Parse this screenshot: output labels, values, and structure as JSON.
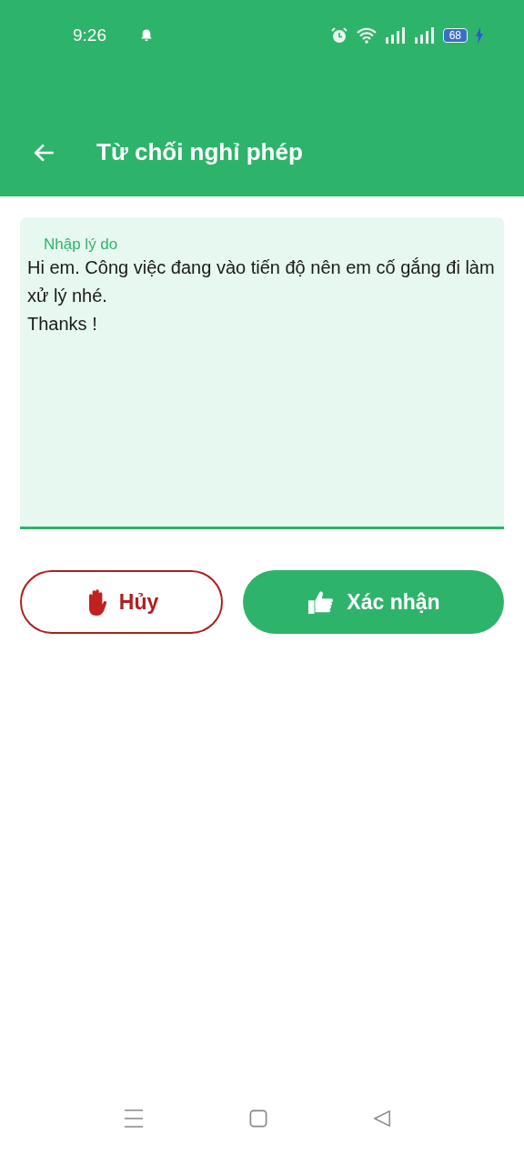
{
  "status_bar": {
    "time": "9:26",
    "battery": "68"
  },
  "app_bar": {
    "title": "Từ chối nghỉ phép"
  },
  "reason_field": {
    "label": "Nhập lý do",
    "value": "Hi em. Công việc đang vào tiến độ nên em cố gắng đi làm xử lý nhé.\nThanks !"
  },
  "buttons": [
    {
      "kind": "cancel",
      "label": "Hủy"
    },
    {
      "kind": "confirm",
      "label": "Xác nhận"
    }
  ]
}
